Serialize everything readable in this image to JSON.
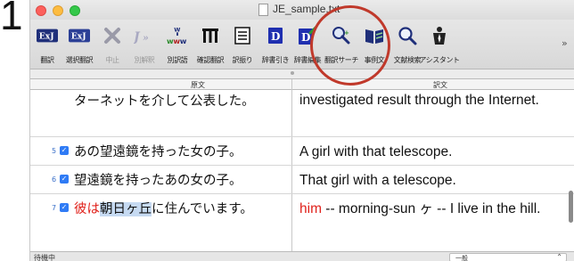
{
  "step_number": "1",
  "window": {
    "title": "JE_sample.txt"
  },
  "toolbar": {
    "buttons": [
      {
        "label": "翻訳",
        "icon": "translate-icon"
      },
      {
        "label": "選択翻訳",
        "icon": "translate-selection-icon"
      },
      {
        "label": "中止",
        "icon": "stop-icon",
        "disabled": true
      },
      {
        "label": "別解釈",
        "icon": "reinterpret-icon",
        "disabled": true
      },
      {
        "label": "別訳語",
        "icon": "alternate-word-icon"
      },
      {
        "label": "確認翻訳",
        "icon": "confirm-translation-icon"
      },
      {
        "label": "訳振り",
        "icon": "ruby-translation-icon"
      },
      {
        "label": "辞書引き",
        "icon": "dictionary-lookup-icon"
      },
      {
        "label": "辞書編集",
        "icon": "dictionary-edit-icon"
      },
      {
        "label": "翻訳サーチ",
        "icon": "translation-search-icon"
      },
      {
        "label": "事例文",
        "icon": "example-sentence-icon"
      },
      {
        "label": "文献検索",
        "icon": "literature-search-icon"
      },
      {
        "label": "アシスタント",
        "icon": "assistant-icon"
      }
    ],
    "overflow": "»"
  },
  "table": {
    "header_source": "原文",
    "header_target": "訳文",
    "rows": [
      {
        "num": "",
        "checked": false,
        "src": "ターネットを介して公表した。",
        "tgt": "investigated result through the Internet."
      },
      {
        "num": "5",
        "checked": true,
        "src": "あの望遠鏡を持った女の子。",
        "tgt": "A girl with that telescope."
      },
      {
        "num": "6",
        "checked": true,
        "src": "望遠鏡を持ったあの女の子。",
        "tgt": "That girl with a telescope."
      },
      {
        "num": "7",
        "checked": true,
        "src_red": "彼は",
        "src_selected": "朝日ヶ丘",
        "src_rest": "に住んでいます。",
        "tgt_red": "him",
        "tgt_rest": " -- morning-sun ヶ -- I live in the hill."
      }
    ]
  },
  "status": {
    "left": "待機中",
    "select_value": "一般"
  },
  "colors": {
    "highlight_circle": "#c0392b",
    "untranslated_text": "#e0221c",
    "selection": "#c6daf2",
    "checkbox": "#2f7bf5"
  }
}
